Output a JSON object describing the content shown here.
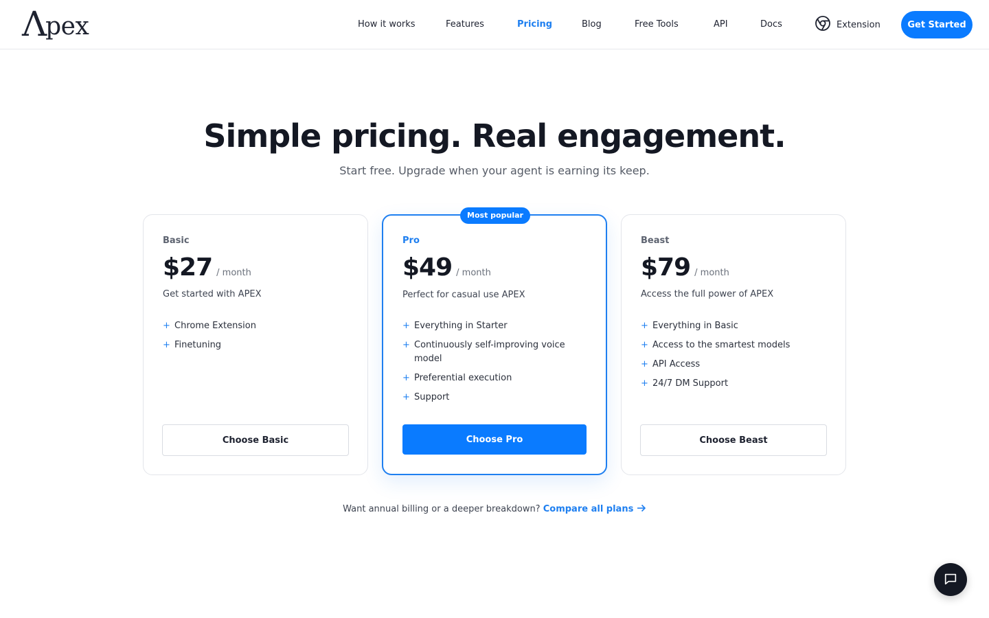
{
  "header": {
    "logo_first": "Λ",
    "logo_rest": "pex",
    "nav": [
      {
        "label": "How it works"
      },
      {
        "label": "Features"
      },
      {
        "label": "Pricing"
      },
      {
        "label": "Blog"
      },
      {
        "label": "Free Tools"
      },
      {
        "label": "API"
      },
      {
        "label": "Docs"
      }
    ],
    "active_nav": "Pricing",
    "extension_label": "Extension",
    "extension_icon": "chrome-icon",
    "cta_label": "Get Started"
  },
  "hero": {
    "title": "Simple pricing. Real engagement.",
    "subtitle": "Start free. Upgrade when your agent is earning its keep."
  },
  "plans": [
    {
      "name": "Basic",
      "price": "$27",
      "period": "/ month",
      "description": "Get started with APEX",
      "features": [
        "Chrome Extension",
        "Finetuning"
      ],
      "button": "Choose Basic"
    },
    {
      "name": "Pro",
      "badge": "Most popular",
      "price": "$49",
      "period": "/ month",
      "description": "Perfect for casual use APEX",
      "features": [
        "Everything in Starter",
        "Continuously self-improving voice model",
        "Preferential execution",
        "Support"
      ],
      "button": "Choose Pro"
    },
    {
      "name": "Beast",
      "price": "$79",
      "period": "/ month",
      "description": "Access the full power of APEX",
      "features": [
        "Everything in Basic",
        "Access to the smartest models",
        "API Access",
        "24/7 DM Support"
      ],
      "button": "Choose Beast"
    }
  ],
  "compare": {
    "text": "Want annual billing or a deeper breakdown?",
    "link": "Compare all plans"
  },
  "colors": {
    "accent": "#0a7bff",
    "text_dark": "#141823",
    "border": "#e3e5ea"
  }
}
